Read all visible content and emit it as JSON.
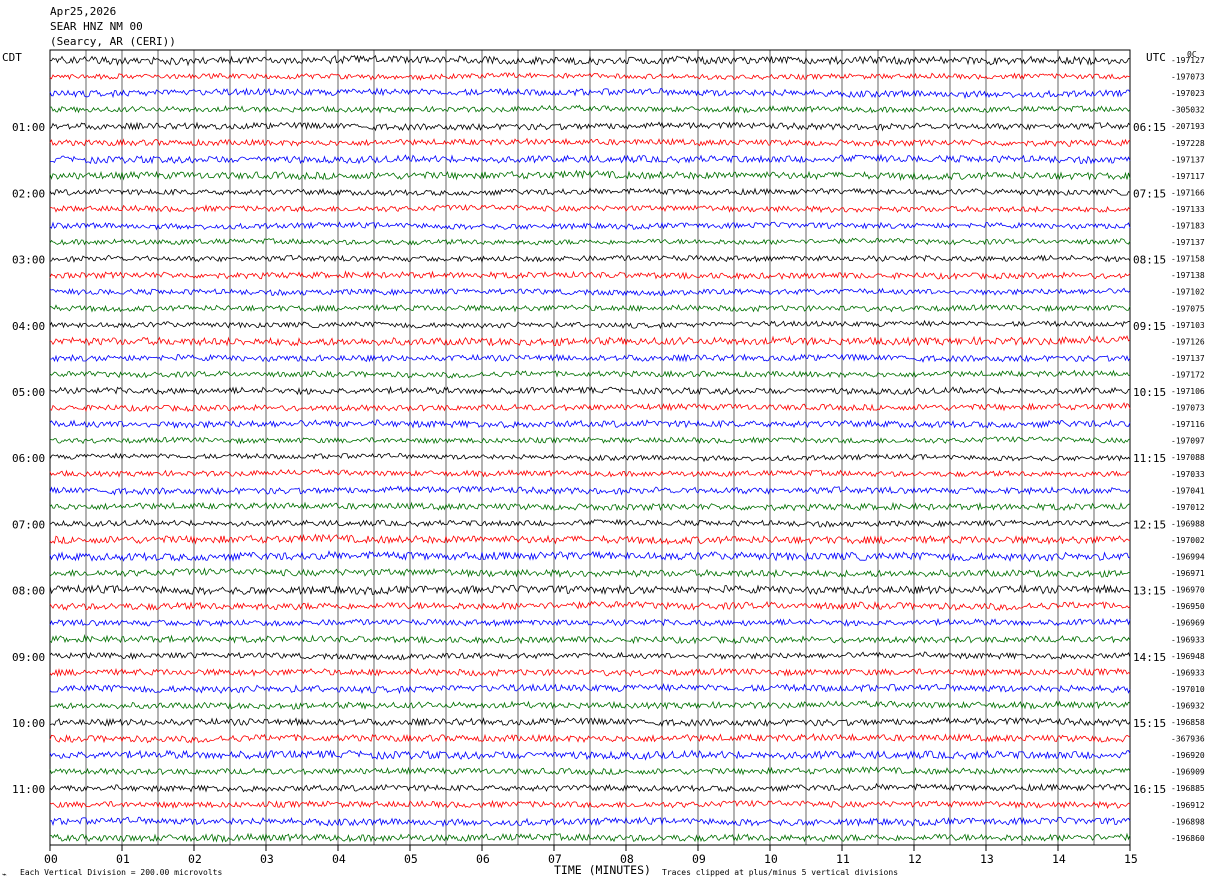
{
  "header": {
    "date": "Apr25,2026",
    "station": "SEAR HNZ NM 00",
    "location": "(Searcy, AR (CERI))"
  },
  "left_timezone": "CDT",
  "right_timezone": "UTC",
  "corner_mark": "0C",
  "left_hour_labels": [
    "01:00",
    "02:00",
    "03:00",
    "04:00",
    "05:00",
    "06:00",
    "07:00",
    "08:00",
    "09:00",
    "10:00",
    "11:00"
  ],
  "right_hour_labels": [
    "06:15",
    "07:15",
    "08:15",
    "09:15",
    "10:15",
    "11:15",
    "12:15",
    "13:15",
    "14:15",
    "15:15",
    "16:15"
  ],
  "footer": {
    "scale_note": "Each Vertical Division =  200.00 microvolts",
    "xaxis_title": "TIME (MINUTES)",
    "clip_note": "Traces clipped at plus/minus 5 vertical divisions"
  },
  "chart_data": {
    "type": "line",
    "title": "SEAR HNZ NM 00",
    "xlabel": "TIME (MINUTES)",
    "ylabel": "",
    "xlim": [
      0,
      15
    ],
    "x_ticks": [
      "00",
      "01",
      "02",
      "03",
      "04",
      "05",
      "06",
      "07",
      "08",
      "09",
      "10",
      "11",
      "12",
      "13",
      "14",
      "15"
    ],
    "grid": true,
    "trace_colors": [
      "#000000",
      "#ff0000",
      "#0000ff",
      "#007000"
    ],
    "trace_offsets": [
      "-197127",
      "-197073",
      "-197023",
      "-305032",
      "-207193",
      "-197228",
      "-197137",
      "-197117",
      "-197166",
      "-197133",
      "-197183",
      "-197137",
      "-197158",
      "-197138",
      "-197102",
      "-197075",
      "-197103",
      "-197126",
      "-197137",
      "-197172",
      "-197106",
      "-197073",
      "-197116",
      "-197097",
      "-197088",
      "-197033",
      "-197041",
      "-197012",
      "-196988",
      "-197002",
      "-196994",
      "-196971",
      "-196970",
      "-196950",
      "-196969",
      "-196933",
      "-196948",
      "-196933",
      "-197010",
      "-196932",
      "-196858",
      "-367936",
      "-196920",
      "-196909",
      "-196885",
      "-196912",
      "-196898",
      "-196860"
    ]
  }
}
